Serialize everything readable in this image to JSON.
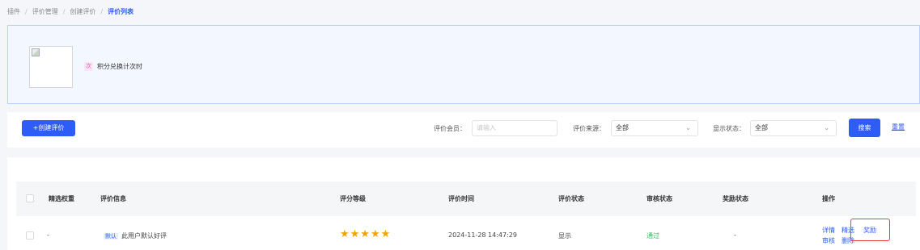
{
  "breadcrumb": {
    "items": [
      "插件",
      "评价管理",
      "创建评价"
    ],
    "current": "评价列表"
  },
  "product": {
    "tag": "次",
    "name": "积分兑换计次时"
  },
  "toolbar": {
    "create_label": "+创建评价",
    "member_label": "评价会员：",
    "member_placeholder": "请输入",
    "source_label": "评价来源：",
    "source_value": "全部",
    "display_label": "显示状态：",
    "display_value": "全部",
    "search_label": "搜索",
    "reset_label": "重置"
  },
  "table": {
    "headers": [
      "精选权重",
      "评价信息",
      "评分等级",
      "评价时间",
      "评价状态",
      "审核状态",
      "奖励状态",
      "操作"
    ],
    "rows": [
      {
        "weight": "-",
        "tag": "默认",
        "info": "此用户默认好评",
        "rating": 5,
        "stars": "★★★★★",
        "time": "2024-11-28 14:47:29",
        "status": "显示",
        "audit": "通过",
        "reward": "-",
        "actions": [
          "详情",
          "精选",
          "奖励",
          "审核",
          "删除"
        ]
      }
    ]
  },
  "colors": {
    "accent": "#2d5cf6",
    "pass": "#31b55c",
    "star": "#f0a400",
    "highlight": "#e04040"
  }
}
